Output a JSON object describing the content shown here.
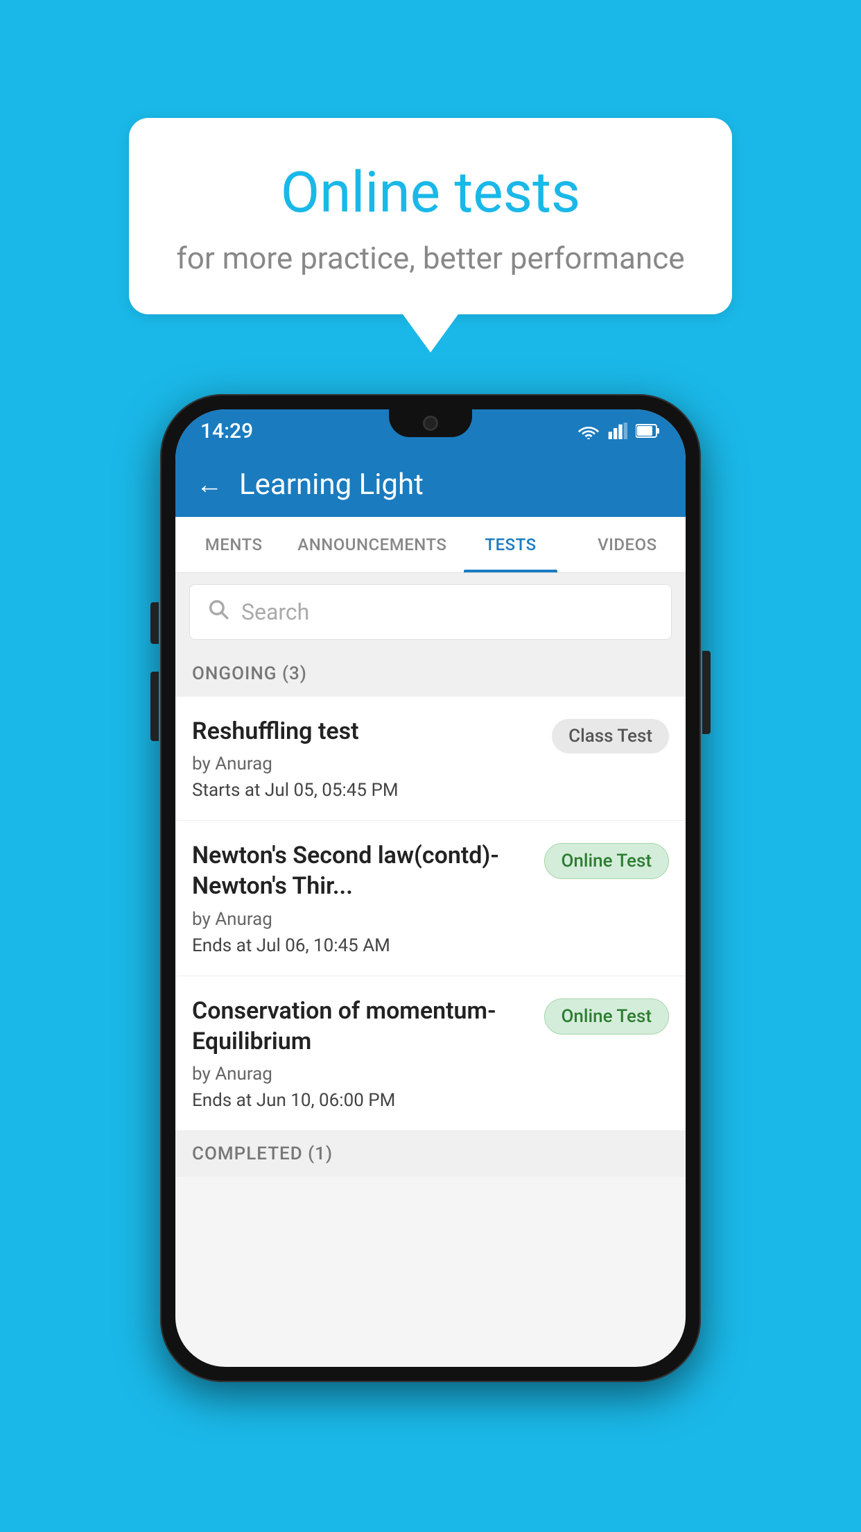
{
  "background_color": "#1ab8e8",
  "speech_bubble": {
    "title": "Online tests",
    "subtitle": "for more practice, better performance"
  },
  "phone": {
    "status_bar": {
      "time": "14:29"
    },
    "header": {
      "title": "Learning Light",
      "back_label": "←"
    },
    "tabs": [
      {
        "label": "MENTS",
        "active": false
      },
      {
        "label": "ANNOUNCEMENTS",
        "active": false
      },
      {
        "label": "TESTS",
        "active": true
      },
      {
        "label": "VIDEOS",
        "active": false
      }
    ],
    "search": {
      "placeholder": "Search"
    },
    "sections": [
      {
        "header": "ONGOING (3)",
        "tests": [
          {
            "name": "Reshuffling test",
            "author": "by Anurag",
            "time_label": "Starts at",
            "time_value": "Jul 05, 05:45 PM",
            "badge": "Class Test",
            "badge_type": "class"
          },
          {
            "name": "Newton's Second law(contd)-Newton's Thir...",
            "author": "by Anurag",
            "time_label": "Ends at",
            "time_value": "Jul 06, 10:45 AM",
            "badge": "Online Test",
            "badge_type": "online"
          },
          {
            "name": "Conservation of momentum-Equilibrium",
            "author": "by Anurag",
            "time_label": "Ends at",
            "time_value": "Jun 10, 06:00 PM",
            "badge": "Online Test",
            "badge_type": "online"
          }
        ]
      }
    ],
    "completed_header": "COMPLETED (1)"
  }
}
